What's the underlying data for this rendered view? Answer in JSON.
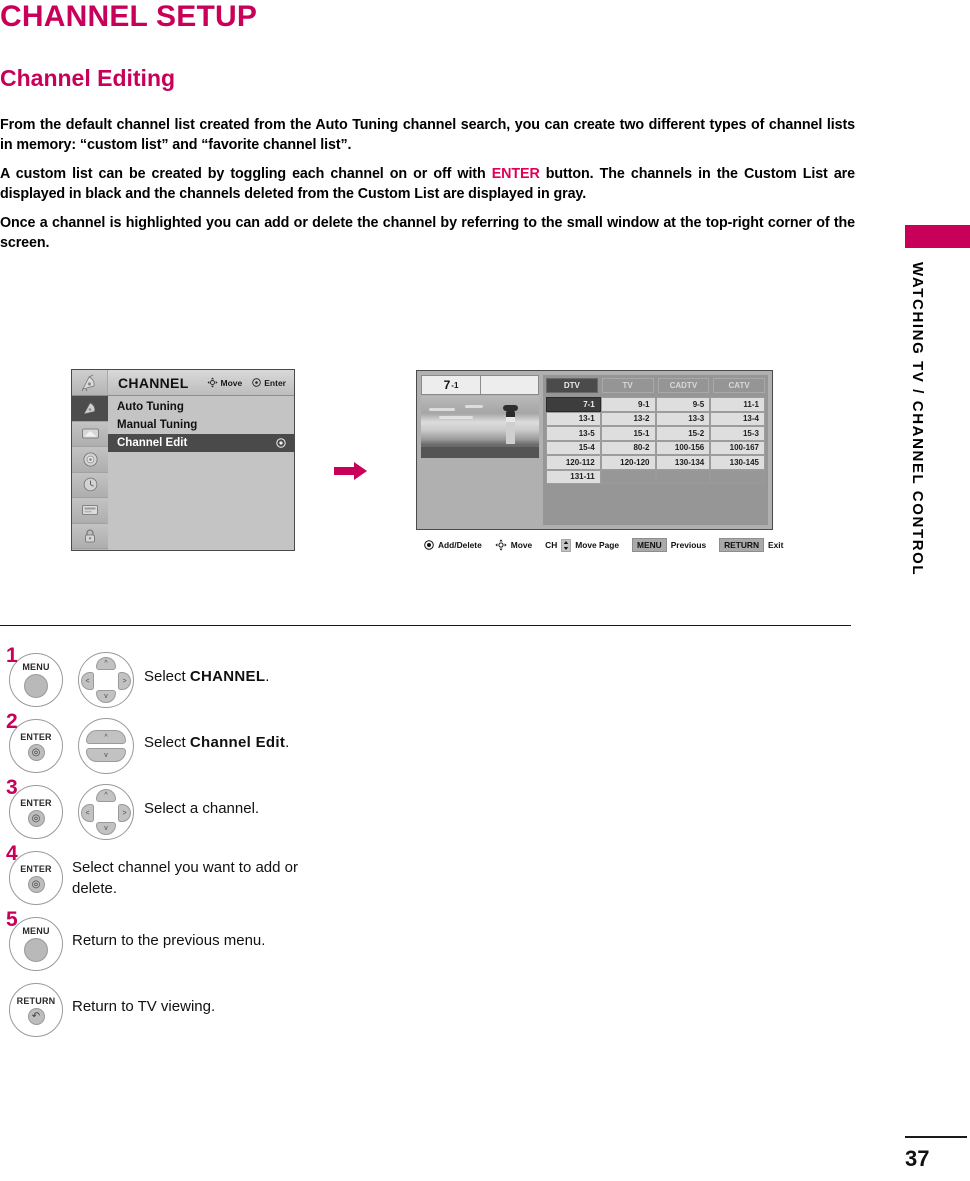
{
  "page": {
    "title": "CHANNEL SETUP",
    "section": "Channel Editing",
    "side_label": "WATCHING TV / CHANNEL CONTROL",
    "page_number": "37",
    "accent_color": "#c8005a"
  },
  "paragraphs": {
    "p1": "From the default channel list created from the Auto Tuning channel search, you can create two different types of channel lists in memory: “custom list” and “favorite channel list”.",
    "p2_before": "A custom list can be created by toggling each channel on or off with ",
    "p2_accent": "ENTER",
    "p2_after": " button. The channels in the Custom List are displayed in black and the channels deleted from the Custom List are displayed in gray.",
    "p3": "Once a channel is highlighted you can add or delete the channel by referring to the small window at the top-right corner of the screen."
  },
  "osd_menu": {
    "header_title": "CHANNEL",
    "hint_move": "Move",
    "hint_enter": "Enter",
    "rail_icons": [
      "satellite-dish-icon",
      "picture-screen-icon",
      "audio-speaker-icon",
      "time-clock-icon",
      "option-box-icon",
      "lock-padlock-icon"
    ],
    "items": [
      {
        "label": "Auto Tuning",
        "selected": false
      },
      {
        "label": "Manual Tuning",
        "selected": false
      },
      {
        "label": "Channel Edit",
        "selected": true
      }
    ]
  },
  "osd_edit": {
    "preview_channel_major": "7",
    "preview_channel_minor": "-1",
    "tabs": [
      {
        "label": "DTV",
        "active": true
      },
      {
        "label": "TV",
        "active": false
      },
      {
        "label": "CADTV",
        "active": false
      },
      {
        "label": "CATV",
        "active": false
      }
    ],
    "grid_rows": [
      [
        "7-1",
        "9-1",
        "9-5",
        "11-1"
      ],
      [
        "13-1",
        "13-2",
        "13-3",
        "13-4"
      ],
      [
        "13-5",
        "15-1",
        "15-2",
        "15-3"
      ],
      [
        "15-4",
        "80-2",
        "100-156",
        "100-167"
      ],
      [
        "120-112",
        "120-120",
        "130-134",
        "130-145"
      ],
      [
        "131-11",
        "",
        "",
        ""
      ]
    ],
    "highlight_cell": "7-1",
    "hints": [
      {
        "icon": "enter-circle-icon",
        "label": "Add/Delete"
      },
      {
        "icon": "dpad-icon",
        "label": "Move"
      },
      {
        "icon": "ch-updown-icon",
        "prefix": "CH",
        "label": "Move Page"
      },
      {
        "icon": "menu-key-icon",
        "key": "MENU",
        "label": "Previous"
      },
      {
        "icon": "return-key-icon",
        "key": "RETURN",
        "label": "Exit"
      }
    ]
  },
  "steps": [
    {
      "number": "1",
      "button": "MENU",
      "button_kind": "plain",
      "pad": "four-way",
      "text_prefix": "Select ",
      "text_bold": "CHANNEL",
      "text_suffix": "."
    },
    {
      "number": "2",
      "button": "ENTER",
      "button_kind": "enter",
      "pad": "up-down",
      "text_prefix": "Select ",
      "text_bold": "Channel Edit",
      "text_suffix": "."
    },
    {
      "number": "3",
      "button": "ENTER",
      "button_kind": "enter",
      "pad": "four-way",
      "text_prefix": "Select a channel.",
      "text_bold": "",
      "text_suffix": ""
    },
    {
      "number": "4",
      "button": "ENTER",
      "button_kind": "enter",
      "pad": "none",
      "text_prefix": "Select channel you want to add or delete.",
      "text_bold": "",
      "text_suffix": ""
    },
    {
      "number": "5",
      "button": "MENU",
      "button_kind": "plain",
      "pad": "none",
      "text_prefix": "Return to the previous menu.",
      "text_bold": "",
      "text_suffix": ""
    },
    {
      "number": "",
      "button": "RETURN",
      "button_kind": "return",
      "pad": "none",
      "text_prefix": "Return to TV viewing.",
      "text_bold": "",
      "text_suffix": ""
    }
  ]
}
